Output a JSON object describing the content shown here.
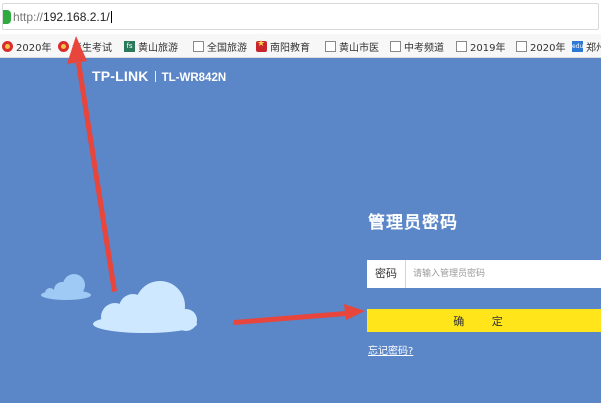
{
  "browser": {
    "url_protocol": "http://",
    "url_host": "192.168.2.1/",
    "bookmarks": [
      {
        "label": "2020年",
        "icon": "flag-icon"
      },
      {
        "label": "考生考试",
        "icon": "flag-icon"
      },
      {
        "label": "黄山旅游",
        "icon": "fs-site-icon"
      },
      {
        "label": "全国旅游",
        "icon": "page-icon"
      },
      {
        "label": "南阳教育",
        "icon": "star-icon"
      },
      {
        "label": "黄山市医",
        "icon": "page-icon"
      },
      {
        "label": "中考频道",
        "icon": "page-icon"
      },
      {
        "label": "2019年",
        "icon": "page-icon"
      },
      {
        "label": "2020年",
        "icon": "page-icon"
      },
      {
        "label": "郑州",
        "icon": "edu-icon"
      }
    ]
  },
  "header": {
    "logo": "TP-LINK",
    "model": "TL-WR842N"
  },
  "login": {
    "title": "管理员密码",
    "password_label": "密码",
    "password_placeholder": "请输入管理员密码",
    "confirm_label": "确 定",
    "forgot_link": "忘记密码?"
  },
  "colors": {
    "page_background": "#5b86c7",
    "confirm_button": "#ffe51a",
    "cloud": "#cde8ff",
    "annotation_arrow": "#e8453c"
  }
}
